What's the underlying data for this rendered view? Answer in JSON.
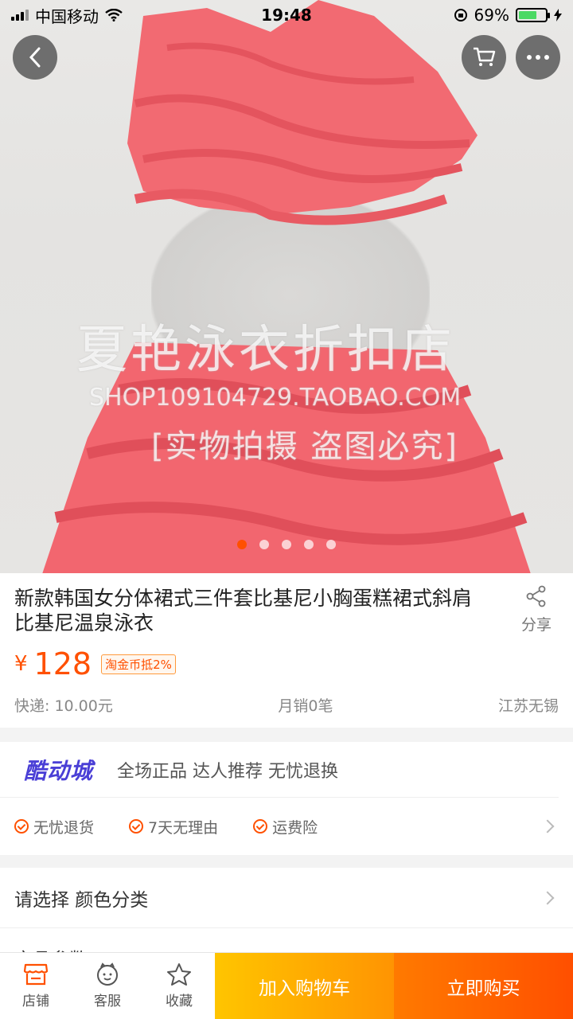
{
  "status_bar": {
    "carrier": "中国移动",
    "time": "19:48",
    "battery_percent": "69%",
    "battery_level": 0.69
  },
  "hero": {
    "watermark_line1": "夏艳泳衣折扣店",
    "watermark_line2": "SHOP109104729.TAOBAO.COM",
    "watermark_line3": "[实物拍摄 盗图必究]",
    "image_count": 5,
    "active_index": 0
  },
  "nav": {
    "back_icon": "chevron-left-icon",
    "cart_icon": "cart-icon",
    "more_icon": "more-icon"
  },
  "product": {
    "title": "新款韩国女分体裙式三件套比基尼小胸蛋糕裙式斜肩比基尼温泉泳衣",
    "share_label": "分享",
    "currency": "¥",
    "price": "128",
    "coin_tag": "淘金币抵2%",
    "shipping": "快递: 10.00元",
    "monthly_sales": "月销0笔",
    "location": "江苏无锡"
  },
  "service": {
    "logo": "酷动城",
    "slogan": "全场正品 达人推荐 无忧退换",
    "items": [
      "无忧退货",
      "7天无理由",
      "运费险"
    ]
  },
  "select": {
    "choose_label": "请选择 颜色分类",
    "params_label": "产品参数"
  },
  "bottom_bar": {
    "shop_label": "店铺",
    "service_label": "客服",
    "favorite_label": "收藏",
    "add_cart_label": "加入购物车",
    "buy_label": "立即购买"
  },
  "colors": {
    "accent": "#ff5000",
    "cart_button": "#ffb300",
    "buy_button": "#ff5a00",
    "logo": "#4a3fd6"
  }
}
